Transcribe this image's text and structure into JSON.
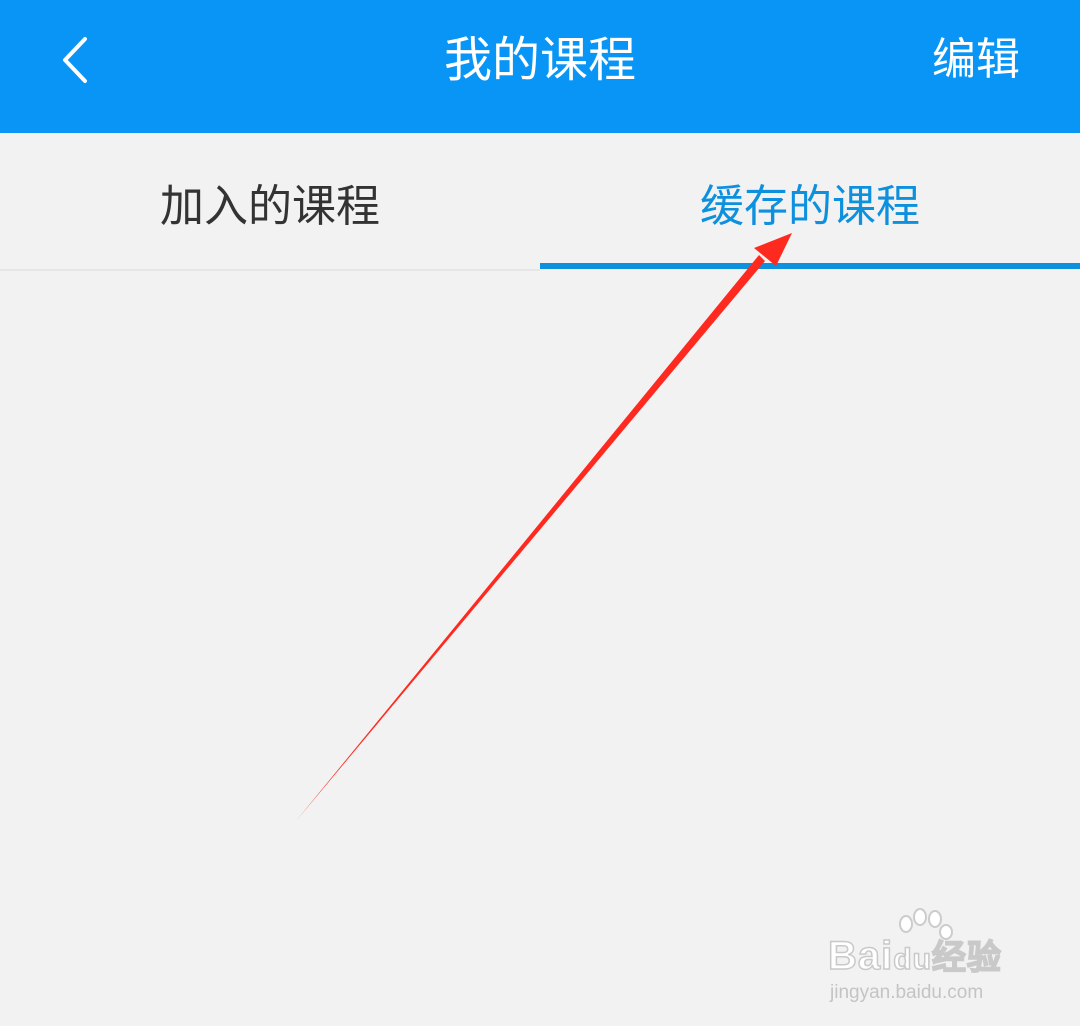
{
  "topbar": {
    "back_icon": "chevron-left-icon",
    "title": "我的课程",
    "edit_label": "编辑",
    "background": "#0995f5"
  },
  "tabs": {
    "items": [
      {
        "label": "加入的课程",
        "active": false
      },
      {
        "label": "缓存的课程",
        "active": true
      }
    ],
    "active_color": "#0d90de",
    "inactive_color": "#333333"
  },
  "annotation": {
    "type": "red-arrow",
    "color": "#ff2a1f",
    "target": "缓存的课程"
  },
  "watermark": {
    "brand": "Bai",
    "brand_suffix": "du",
    "brand_cn": "经验",
    "url": "jingyan.baidu.com"
  }
}
